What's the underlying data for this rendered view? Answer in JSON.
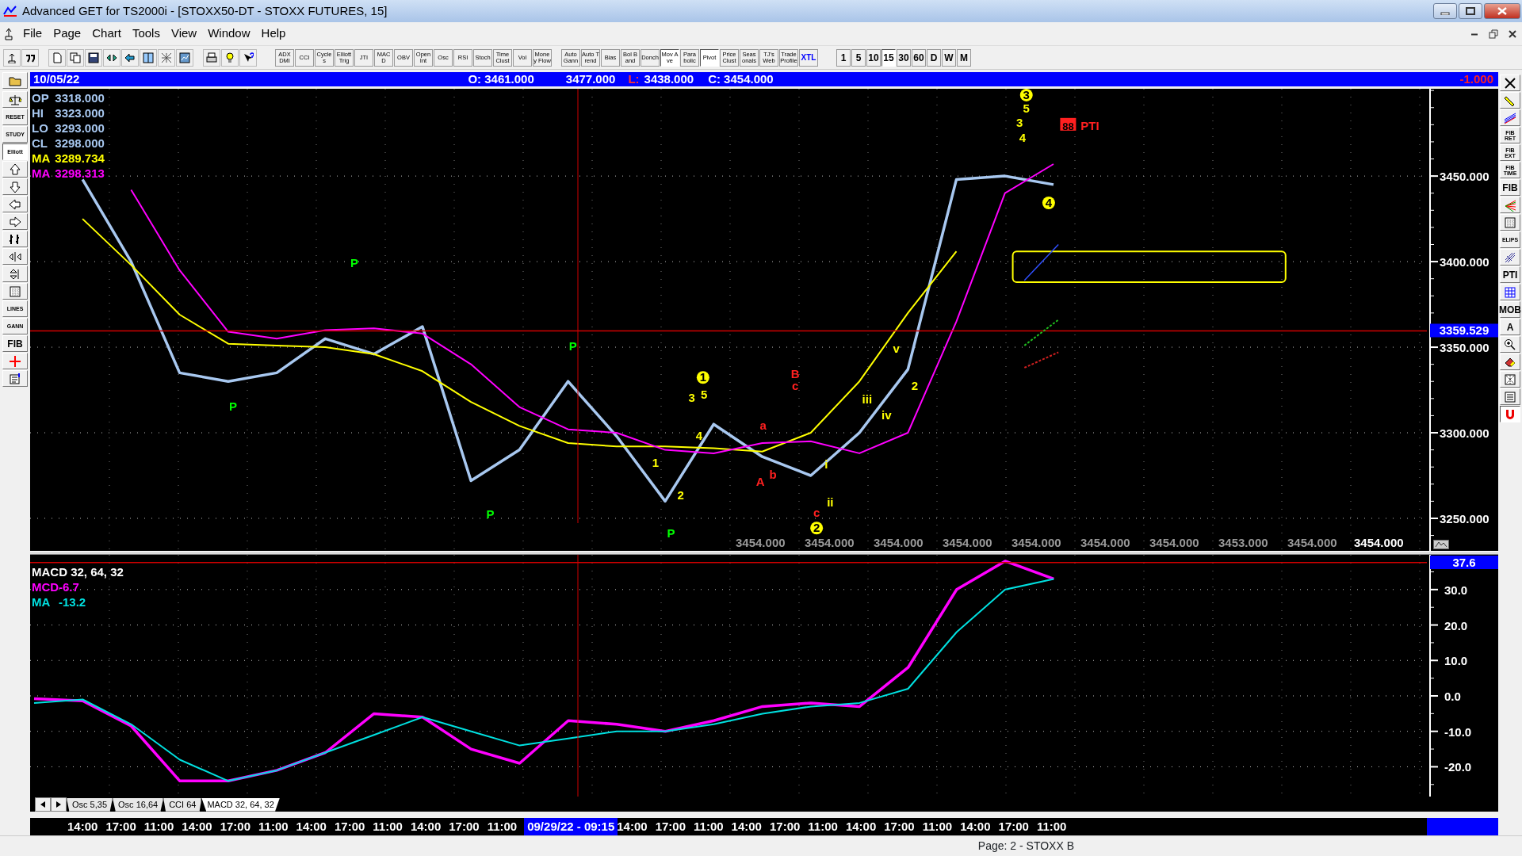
{
  "window": {
    "title": "Advanced GET for TS2000i - [STOXX50-DT - STOXX FUTURES, 15]"
  },
  "menu": [
    "File",
    "Page",
    "Chart",
    "Tools",
    "View",
    "Window",
    "Help"
  ],
  "study_buttons": [
    {
      "label": "ADX DMI",
      "pressed": false
    },
    {
      "label": "CCI",
      "pressed": false
    },
    {
      "label": "Cycles",
      "pressed": false
    },
    {
      "label": "Elliott Trig",
      "pressed": false
    },
    {
      "label": "JTI",
      "pressed": false
    },
    {
      "label": "MACD",
      "pressed": false
    },
    {
      "label": "OBV",
      "pressed": false
    },
    {
      "label": "Open Int",
      "pressed": false
    },
    {
      "label": "Osc",
      "pressed": false
    },
    {
      "label": "RSI",
      "pressed": false
    },
    {
      "label": "Stoch",
      "pressed": false
    },
    {
      "label": "Time Clust",
      "pressed": false
    },
    {
      "label": "Vol",
      "pressed": false
    },
    {
      "label": "Money Flow",
      "pressed": false
    },
    {
      "label": "Auto Gann",
      "pressed": false
    },
    {
      "label": "Auto Trend",
      "pressed": false
    },
    {
      "label": "Bias",
      "pressed": false
    },
    {
      "label": "Bol Band",
      "pressed": false
    },
    {
      "label": "Donch",
      "pressed": false
    },
    {
      "label": "Mov Ave",
      "pressed": true
    },
    {
      "label": "Para bolic",
      "pressed": false
    },
    {
      "label": "Pivot",
      "pressed": true
    },
    {
      "label": "Price Clust",
      "pressed": false
    },
    {
      "label": "Seas onals",
      "pressed": false
    },
    {
      "label": "TJ's Web",
      "pressed": false
    },
    {
      "label": "Trade Profile",
      "pressed": false
    },
    {
      "label": "XTL",
      "pressed": false
    }
  ],
  "interval_buttons": [
    {
      "label": "1",
      "selected": false
    },
    {
      "label": "5",
      "selected": false
    },
    {
      "label": "10",
      "selected": false
    },
    {
      "label": "15",
      "selected": true
    },
    {
      "label": "30",
      "selected": false
    },
    {
      "label": "60",
      "selected": false
    },
    {
      "label": "D",
      "selected": false
    },
    {
      "label": "W",
      "selected": false
    },
    {
      "label": "M",
      "selected": false
    }
  ],
  "left_toolbar": [
    {
      "kind": "icon",
      "pressed": false
    },
    {
      "kind": "icon",
      "pressed": false
    },
    {
      "kind": "labeled",
      "label": "RESET",
      "pressed": false
    },
    {
      "kind": "labeled",
      "label": "STUDY",
      "pressed": false
    },
    {
      "kind": "labeled",
      "label": "Elliott",
      "pressed": true
    },
    {
      "kind": "icon",
      "pressed": false
    },
    {
      "kind": "icon",
      "pressed": false
    },
    {
      "kind": "icon",
      "pressed": false
    },
    {
      "kind": "icon",
      "pressed": false
    },
    {
      "kind": "icon",
      "pressed": false
    },
    {
      "kind": "icon",
      "pressed": false
    },
    {
      "kind": "icon",
      "pressed": false
    },
    {
      "kind": "icon",
      "pressed": false
    },
    {
      "kind": "labeled",
      "label": "LINES",
      "pressed": false
    },
    {
      "kind": "labeled",
      "label": "GANN",
      "pressed": false
    },
    {
      "kind": "labeled",
      "label": "FIB",
      "pressed": false
    },
    {
      "kind": "icon",
      "pressed": false
    },
    {
      "kind": "icon",
      "pressed": false
    }
  ],
  "right_toolbar": [
    {
      "kind": "icon",
      "pressed": false
    },
    {
      "kind": "icon",
      "pressed": false
    },
    {
      "kind": "icon",
      "pressed": false
    },
    {
      "kind": "labeled",
      "label": "FIB RET",
      "pressed": false
    },
    {
      "kind": "labeled",
      "label": "FIB EXT",
      "pressed": false
    },
    {
      "kind": "labeled",
      "label": "FIB TIME",
      "pressed": false
    },
    {
      "kind": "labeled",
      "label": "FIB",
      "pressed": false
    },
    {
      "kind": "icon",
      "pressed": false
    },
    {
      "kind": "icon",
      "pressed": false
    },
    {
      "kind": "labeled",
      "label": "ELIPS",
      "pressed": false
    },
    {
      "kind": "icon",
      "pressed": false
    },
    {
      "kind": "labeled",
      "label": "PTI",
      "pressed": false
    },
    {
      "kind": "icon",
      "pressed": false
    },
    {
      "kind": "labeled",
      "label": "MOB",
      "pressed": false
    },
    {
      "kind": "labeled",
      "label": "A",
      "pressed": false
    },
    {
      "kind": "icon",
      "pressed": false
    },
    {
      "kind": "icon",
      "pressed": false
    },
    {
      "kind": "icon",
      "pressed": false
    },
    {
      "kind": "icon",
      "pressed": false
    },
    {
      "kind": "icon",
      "pressed": true
    }
  ],
  "quote_bar": {
    "date": "10/05/22",
    "open": "O: 3461.000",
    "high": "3477.000",
    "low_label": "L:",
    "low": "3438.000",
    "close": "C: 3454.000",
    "change": "-1.000"
  },
  "price_pane": {
    "legend": [
      {
        "label": "OP",
        "value": "3318.000",
        "color": "#a8c8f0"
      },
      {
        "label": "HI",
        "value": "3323.000",
        "color": "#a8c8f0"
      },
      {
        "label": "LO",
        "value": "3293.000",
        "color": "#a8c8f0"
      },
      {
        "label": "CL",
        "value": "3298.000",
        "color": "#a8c8f0"
      },
      {
        "label": "MA",
        "value": "3289.734",
        "color": "#ffff00"
      },
      {
        "label": "MA",
        "value": "3298.313",
        "color": "#ff00ff"
      }
    ],
    "cursor_price": "3359.529",
    "footer_values": [
      {
        "text": "3454.000",
        "highlighted": false
      },
      {
        "text": "3454.000",
        "highlighted": false
      },
      {
        "text": "3454.000",
        "highlighted": false
      },
      {
        "text": "3454.000",
        "highlighted": false
      },
      {
        "text": "3454.000",
        "highlighted": false
      },
      {
        "text": "3454.000",
        "highlighted": false
      },
      {
        "text": "3454.000",
        "highlighted": false
      },
      {
        "text": "3453.000",
        "highlighted": false
      },
      {
        "text": "3454.000",
        "highlighted": false
      },
      {
        "text": "3454.000",
        "highlighted": true
      }
    ],
    "wave_labels": [
      {
        "text": "P",
        "color": "#00ff00"
      },
      {
        "text": "P",
        "color": "#00ff00"
      },
      {
        "text": "P",
        "color": "#00ff00"
      },
      {
        "text": "P",
        "color": "#00ff00"
      },
      {
        "text": "P",
        "color": "#00ff00"
      },
      {
        "text": "1",
        "color": "#ffff00",
        "circled": true
      },
      {
        "text": "3",
        "color": "#ffff00"
      },
      {
        "text": "5",
        "color": "#ffff00"
      },
      {
        "text": "4",
        "color": "#ffff00"
      },
      {
        "text": "1",
        "color": "#ffff00"
      },
      {
        "text": "2",
        "color": "#ffff00"
      },
      {
        "text": "B",
        "color": "#ff2020"
      },
      {
        "text": "c",
        "color": "#ff2020"
      },
      {
        "text": "a",
        "color": "#ff2020"
      },
      {
        "text": "A",
        "color": "#ff2020"
      },
      {
        "text": "b",
        "color": "#ff2020"
      },
      {
        "text": "c",
        "color": "#ff2020"
      },
      {
        "text": "2",
        "color": "#ffff00",
        "circled": true
      },
      {
        "text": "i",
        "color": "#ffff00"
      },
      {
        "text": "ii",
        "color": "#ffff00"
      },
      {
        "text": "iii",
        "color": "#ffff00"
      },
      {
        "text": "iv",
        "color": "#ffff00"
      },
      {
        "text": "v",
        "color": "#ffff00"
      },
      {
        "text": "2",
        "color": "#ffff00"
      },
      {
        "text": "3",
        "color": "#ffff00",
        "circled": true
      },
      {
        "text": "5",
        "color": "#ffff00"
      },
      {
        "text": "3",
        "color": "#ffff00"
      },
      {
        "text": "4",
        "color": "#ffff00"
      },
      {
        "text": "4",
        "color": "#ffff00",
        "circled": true
      },
      {
        "text": "88",
        "color": "#ff2020",
        "boxed": true
      },
      {
        "text": "PTI",
        "color": "#ff2020"
      }
    ],
    "chart_data": {
      "type": "line",
      "ylim": [
        3231,
        3501
      ],
      "grid": true,
      "yticks": [
        {
          "value": 3450,
          "label": "3450.000"
        },
        {
          "value": 3400,
          "label": "3400.000"
        },
        {
          "value": 3350,
          "label": "3350.000"
        },
        {
          "value": 3300,
          "label": "3300.000"
        },
        {
          "value": 3250,
          "label": "3250.000"
        }
      ],
      "series": [
        {
          "color": "#a8c8f0",
          "values": [
            3448,
            3400,
            3335,
            3330,
            3335,
            3355,
            3346,
            3362,
            3272,
            3290,
            3330,
            3298,
            3260,
            3305,
            3286,
            3275,
            3300,
            3337,
            3448,
            3450,
            3445
          ]
        },
        {
          "color": "#ffff00",
          "values": [
            3425,
            3398,
            3369,
            3352,
            3351,
            3350,
            3346,
            3336,
            3318,
            3304,
            3294,
            3292,
            3292,
            3291,
            3289,
            3300,
            3330,
            3370,
            3406,
            null,
            null
          ]
        },
        {
          "color": "#ff00ff",
          "values": [
            null,
            3442,
            3395,
            3359,
            3355,
            3360,
            3361,
            3358,
            3340,
            3315,
            3302,
            3300,
            3290,
            3288,
            3294,
            3295,
            3288,
            3300,
            3365,
            3440,
            3457
          ]
        }
      ]
    }
  },
  "macd_pane": {
    "title": "MACD 32, 64, 32",
    "current_value": "37.6",
    "legend": [
      {
        "label": "MCD",
        "value": "-6.7",
        "color": "#ff00ff"
      },
      {
        "label": "MA",
        "value": "-13.2",
        "color": "#00e0e0"
      }
    ],
    "chart_data": {
      "type": "line",
      "ylim": [
        -28.4,
        39.8
      ],
      "grid": true,
      "yticks": [
        {
          "value": 30,
          "label": "30.0"
        },
        {
          "value": 20,
          "label": "20.0"
        },
        {
          "value": 10,
          "label": "10.0"
        },
        {
          "value": 0,
          "label": "0.0"
        },
        {
          "value": -10,
          "label": "-10.0"
        },
        {
          "value": -20,
          "label": "-20.0"
        }
      ],
      "series": [
        {
          "color": "#ff00ff",
          "values": [
            -0.8,
            -1.4,
            -8.5,
            -24,
            -24,
            -21,
            -16,
            -5,
            -6,
            -15,
            -19,
            -7,
            -8,
            -10,
            -7,
            -3,
            -2,
            -3,
            8,
            30,
            38,
            33
          ]
        },
        {
          "color": "#00e0e0",
          "values": [
            -2,
            -1,
            -8,
            -18,
            -24,
            -21,
            -16,
            -11,
            -6,
            -10,
            -14,
            -12,
            -10,
            -10,
            -8,
            -5,
            -3,
            -2,
            2,
            18,
            30,
            33
          ]
        }
      ]
    }
  },
  "tabs": [
    {
      "label": "Osc 5,35",
      "selected": false
    },
    {
      "label": "Osc 16,64",
      "selected": false
    },
    {
      "label": "CCI 64",
      "selected": false
    },
    {
      "label": "MACD 32, 64, 32",
      "selected": true
    }
  ],
  "time_axis": [
    {
      "label": "14:00",
      "selected": false
    },
    {
      "label": "17:00",
      "selected": false
    },
    {
      "label": "11:00",
      "selected": false
    },
    {
      "label": "14:00",
      "selected": false
    },
    {
      "label": "17:00",
      "selected": false
    },
    {
      "label": "11:00",
      "selected": false
    },
    {
      "label": "14:00",
      "selected": false
    },
    {
      "label": "17:00",
      "selected": false
    },
    {
      "label": "11:00",
      "selected": false
    },
    {
      "label": "14:00",
      "selected": false
    },
    {
      "label": "17:00",
      "selected": false
    },
    {
      "label": "11:00",
      "selected": false
    },
    {
      "label": "09/29/22 - 09:15",
      "selected": true
    },
    {
      "label": "14:00",
      "selected": false
    },
    {
      "label": "17:00",
      "selected": false
    },
    {
      "label": "11:00",
      "selected": false
    },
    {
      "label": "14:00",
      "selected": false
    },
    {
      "label": "17:00",
      "selected": false
    },
    {
      "label": "11:00",
      "selected": false
    },
    {
      "label": "14:00",
      "selected": false
    },
    {
      "label": "17:00",
      "selected": false
    },
    {
      "label": "11:00",
      "selected": false
    },
    {
      "label": "14:00",
      "selected": false
    },
    {
      "label": "17:00",
      "selected": false
    },
    {
      "label": "11:00",
      "selected": false
    }
  ],
  "status_bar": {
    "text": "Page: 2 - STOXX B"
  }
}
